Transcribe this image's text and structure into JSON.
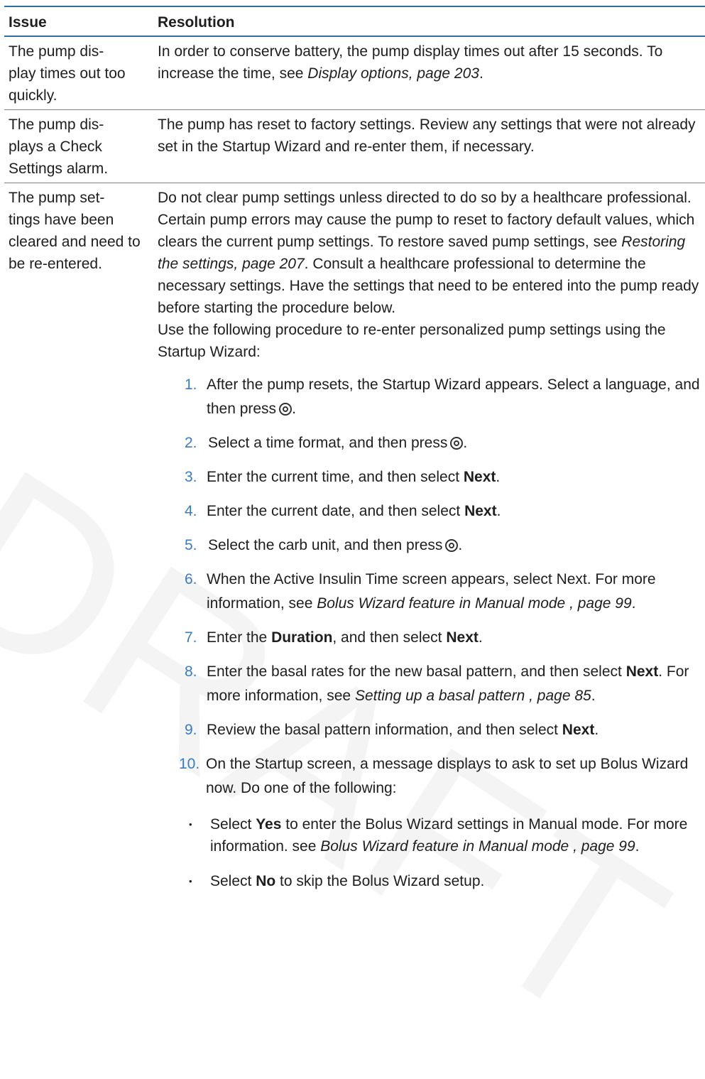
{
  "watermark": "DRAFT",
  "headers": {
    "issue": "Issue",
    "resolution": "Resolution"
  },
  "rows": [
    {
      "issue": "The pump dis-\nplay times out too quickly.",
      "res_text": "In order to conserve battery, the pump display times out after 15 seconds. To increase the time, see ",
      "res_ref": "Display options, page 203",
      "res_end": "."
    },
    {
      "issue": "The pump dis-\nplays a Check Settings alarm.",
      "res_text": "The pump has reset to factory settings. Review any settings that were not already set in the Startup Wizard and re-enter them, if necessary."
    },
    {
      "issue": "The pump set-\ntings have been cleared and need to be re-entered.",
      "res_p1": "Do not clear pump settings unless directed to do so by a healthcare professional. Certain pump errors may cause the pump to reset to factory default values, which clears the current pump settings. To restore saved pump settings, see ",
      "res_p1_ref": "Restoring the settings, page 207",
      "res_p1_end": ". Consult a healthcare professional to determine the necessary settings. Have the settings that need to be entered into the pump ready before starting the procedure below.",
      "res_p2": "Use the following procedure to re-enter personalized pump settings using the Startup Wizard:"
    }
  ],
  "steps": {
    "s1": {
      "num": "1.",
      "text": "After the pump resets, the Startup Wizard appears. Select a language, and then press"
    },
    "s2": {
      "num": "2.",
      "text": "Select a time format, and then press"
    },
    "s3": {
      "num": "3.",
      "text": "Enter the current time, and then select ",
      "bold": "Next"
    },
    "s4": {
      "num": "4.",
      "text": "Enter the current date, and then select ",
      "bold": "Next"
    },
    "s5": {
      "num": "5.",
      "text": "Select the carb unit, and then press"
    },
    "s6": {
      "num": "6.",
      "text": "When the Active Insulin Time screen appears, select Next. For more information, see ",
      "ref": "Bolus Wizard feature in Manual mode , page 99"
    },
    "s7": {
      "num": "7.",
      "text_a": "Enter the ",
      "bold_a": "Duration",
      "text_b": ", and then select ",
      "bold_b": "Next"
    },
    "s8": {
      "num": "8.",
      "text": "Enter the basal rates for the new basal pattern, and then select ",
      "bold": "Next",
      "text_c": ". For more information, see ",
      "ref": "Setting up a basal pattern , page 85"
    },
    "s9": {
      "num": "9.",
      "text": "Review the basal pattern information, and then select ",
      "bold": "Next"
    },
    "s10": {
      "num": "10.",
      "text": "On the Startup screen, a message displays to ask to set up Bolus Wizard now. Do one of the following:"
    }
  },
  "bullets": {
    "b1": {
      "text_a": "Select ",
      "bold": "Yes",
      "text_b": " to enter the Bolus Wizard settings in Manual mode. For more information. see ",
      "ref": "Bolus Wizard feature in Manual mode , page 99"
    },
    "b2": {
      "text_a": "Select ",
      "bold": "No",
      "text_b": " to skip the Bolus Wizard setup."
    }
  },
  "icons": {
    "activate": "select-button-icon",
    "bullet": "•"
  },
  "punct": {
    "period": ".",
    "end_dot": ".",
    "sentence_end": "."
  }
}
